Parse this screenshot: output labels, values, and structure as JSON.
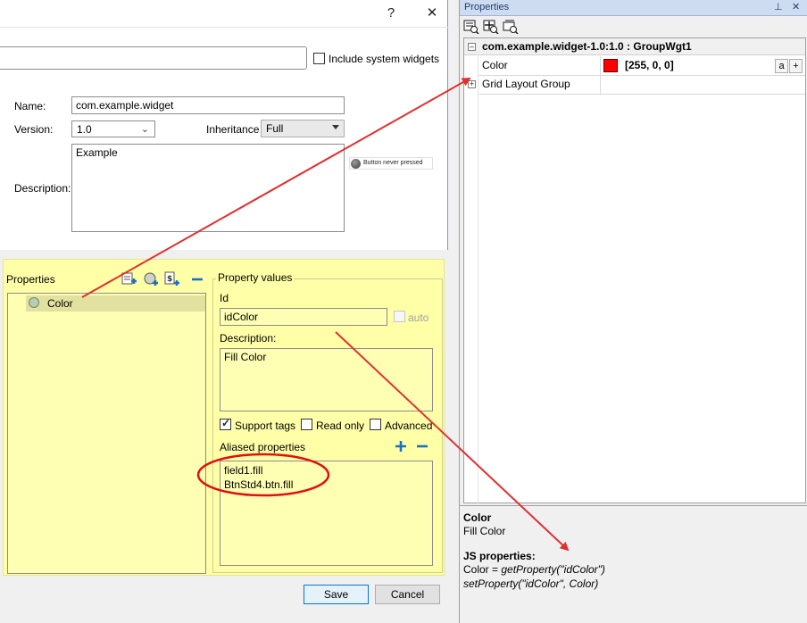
{
  "dialog": {
    "help_label": "?",
    "close_label": "✕",
    "search": {
      "value": ""
    },
    "include_system_widgets_label": "Include system widgets",
    "name_label": "Name:",
    "name_value": "com.example.widget",
    "version_label": "Version:",
    "version_value": "1.0",
    "inheritance_label": "Inheritance",
    "inheritance_value": "Full",
    "description_label": "Description:",
    "description_value": "Example",
    "preview_text": "Button never pressed",
    "properties_label": "Properties",
    "property_items": [
      {
        "label": "Color"
      }
    ],
    "property_values_label": "Property values",
    "id_label": "Id",
    "id_value": "idColor",
    "auto_label": "auto",
    "desc_label": "Description:",
    "desc_value": "Fill Color",
    "support_tags_label": "Support tags",
    "read_only_label": "Read only",
    "advanced_label": "Advanced",
    "aliased_label": "Aliased properties",
    "aliased_items": [
      "field1.fill",
      "BtnStd4.btn.fill"
    ],
    "save_label": "Save",
    "cancel_label": "Cancel"
  },
  "props_panel": {
    "title": "Properties",
    "pin_label": "⊥",
    "close_label": "✕",
    "group_header": "com.example.widget-1.0:1.0 : GroupWgt1",
    "rows": [
      {
        "name": "Color",
        "value": "[255, 0, 0]",
        "swatch": "#ff0000",
        "btn_a": "a",
        "btn_plus": "+"
      },
      {
        "name": "Grid Layout Group",
        "value": ""
      }
    ],
    "info_title": "Color",
    "info_desc": "Fill Color",
    "js_title": "JS properties:",
    "js_getter_prefix": "Color = ",
    "js_getter_call": "getProperty(\"idColor\")",
    "js_setter": "setProperty(\"idColor\", Color)"
  },
  "colors": {
    "annotation": "#e03030",
    "yellow_bg": "#ffffa8",
    "accent": "#0078d7"
  }
}
